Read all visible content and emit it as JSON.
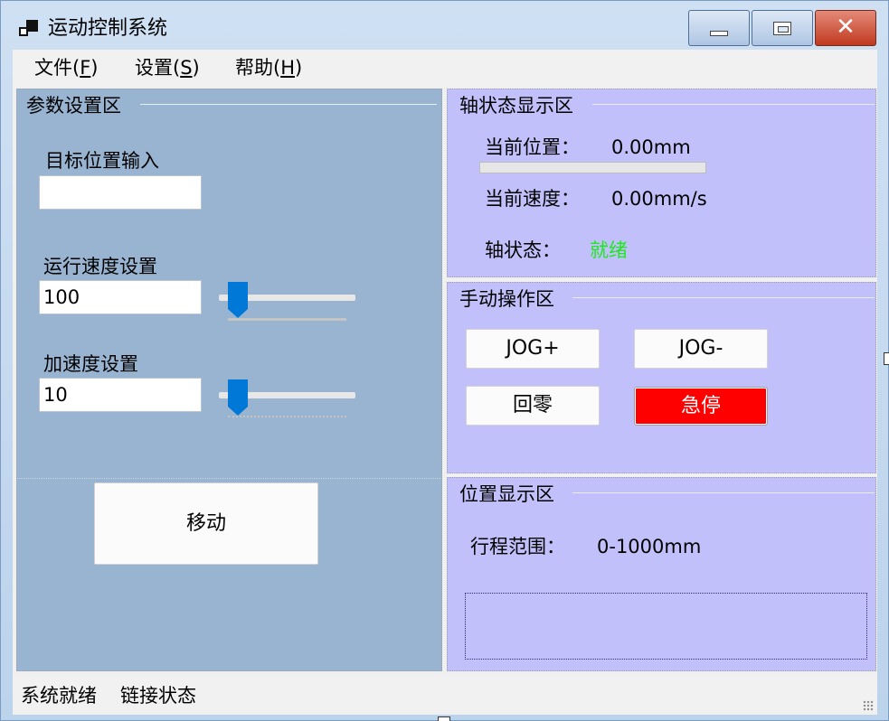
{
  "window": {
    "title": "运动控制系统",
    "icons": {
      "app": "app-window-icon",
      "minimize": "minimize-icon",
      "maximize": "maximize-icon",
      "close": "close-icon"
    },
    "close_glyph": "✕"
  },
  "menu": {
    "items": [
      {
        "text": "文件(",
        "accel": "F",
        "tail": ")"
      },
      {
        "text": "设置(",
        "accel": "S",
        "tail": ")"
      },
      {
        "text": "帮助(",
        "accel": "H",
        "tail": ")"
      }
    ]
  },
  "params": {
    "title": "参数设置区",
    "target_label": "目标位置输入",
    "target_value": "",
    "speed_label": "运行速度设置",
    "speed_value": "100",
    "speed_slider_level": 0,
    "accel_label": "加速度设置",
    "accel_value": "10",
    "accel_slider_level": 0,
    "move_button": "移动"
  },
  "axis": {
    "title": "轴状态显示区",
    "position_label": "当前位置：",
    "position_value": "0.00mm",
    "position_progress": 0,
    "speed_label": "当前速度：",
    "speed_value": "0.00mm/s",
    "state_label": "轴状态：",
    "state_value": "就绪"
  },
  "manual": {
    "title": "手动操作区",
    "jog_plus": "JOG+",
    "jog_minus": "JOG-",
    "home": "回零",
    "estop": "急停"
  },
  "position": {
    "title": "位置显示区",
    "range_label": "行程范围：",
    "range_value": "0-1000mm"
  },
  "status": {
    "ready": "系统就绪",
    "connection": "链接状态"
  },
  "colors": {
    "left_panel": "#98b4d1",
    "right_panel": "#c2c0fb",
    "ready_green": "#1ee81e",
    "estop_red": "#ff0000",
    "slider_accent": "#0078d7"
  }
}
